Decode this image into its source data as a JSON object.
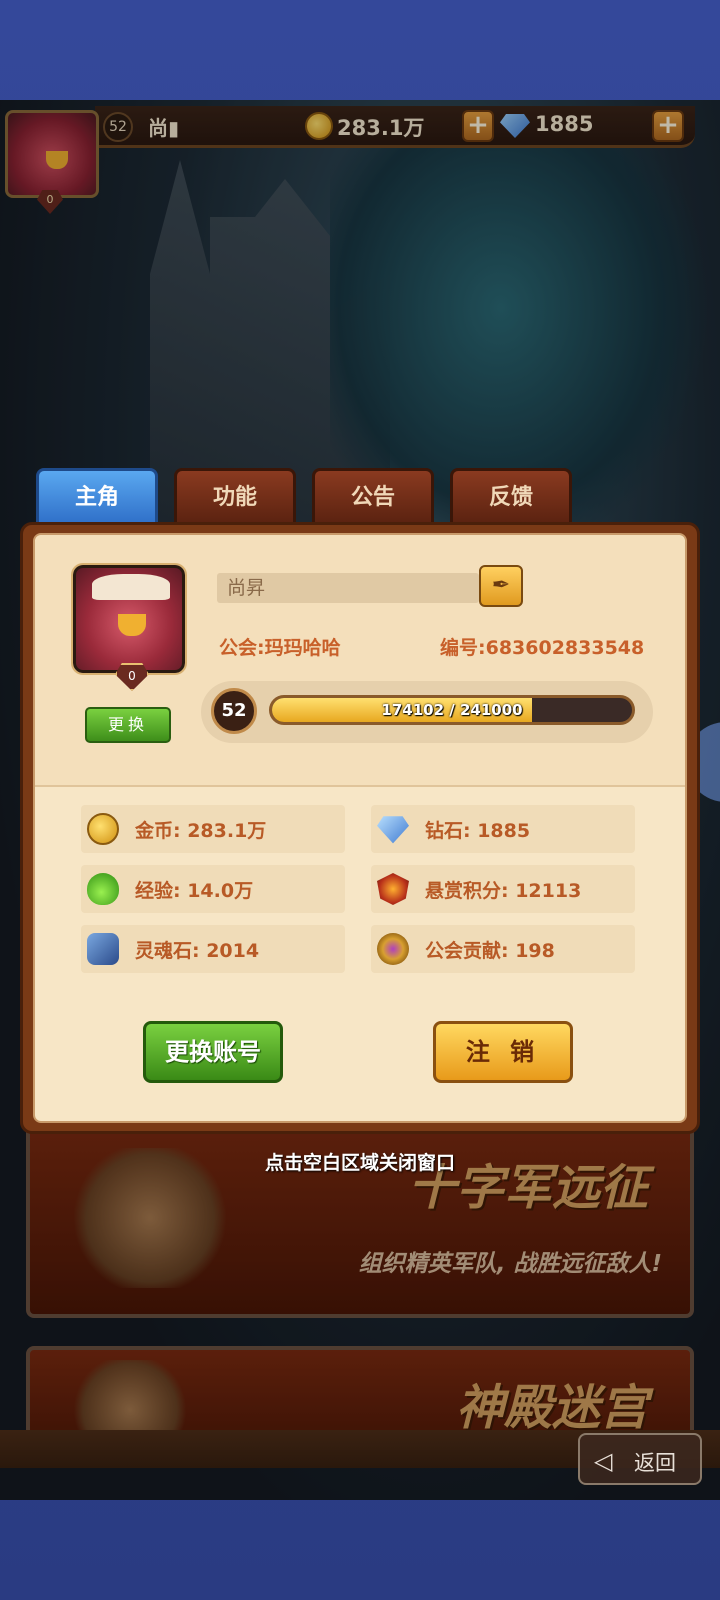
{
  "top_bar": {
    "level": "52",
    "player_name": "尚▮",
    "avatar_badge": "0",
    "gold": "283.1万",
    "diamonds": "1885",
    "add_gold_label": "+",
    "add_diamonds_label": "+"
  },
  "tabs": [
    {
      "label": "主角",
      "active": true
    },
    {
      "label": "功能",
      "active": false
    },
    {
      "label": "公告",
      "active": false
    },
    {
      "label": "反馈",
      "active": false
    }
  ],
  "profile": {
    "avatar_badge": "0",
    "change_avatar_label": "更换",
    "name": "尚昇",
    "edit_icon": "quill-icon",
    "guild": "公会:玛玛哈哈",
    "player_id": "编号:683602833548",
    "level": "52",
    "xp_text": "174102 / 241000",
    "xp_current": 174102,
    "xp_max": 241000
  },
  "stats": [
    {
      "label": "金币:  283.1万",
      "icon": "gold-coin-icon"
    },
    {
      "label": "钻石:  1885",
      "icon": "diamond-icon"
    },
    {
      "label": "经验:  14.0万",
      "icon": "exp-potion-icon"
    },
    {
      "label": "悬赏积分:  12113",
      "icon": "bounty-badge-icon"
    },
    {
      "label": "灵魂石:  2014",
      "icon": "soul-stone-icon"
    },
    {
      "label": "公会贡献:  198",
      "icon": "guild-contribution-icon"
    }
  ],
  "buttons": {
    "switch_account": "更换账号",
    "logout": "注 销"
  },
  "hint": "点击空白区域关闭窗口",
  "banners": [
    {
      "title": "十字军远征",
      "subtitle": "组织精英军队, 战胜远征敌人!"
    },
    {
      "title": "神殿迷宫",
      "subtitle": ""
    }
  ],
  "back_label": "返回",
  "colors": {
    "accent_orange": "#c8602a",
    "tab_active": "#3a82d8",
    "panel_bg": "#f7e6c6",
    "button_green": "#5aae2a",
    "button_yellow": "#f0b030"
  }
}
